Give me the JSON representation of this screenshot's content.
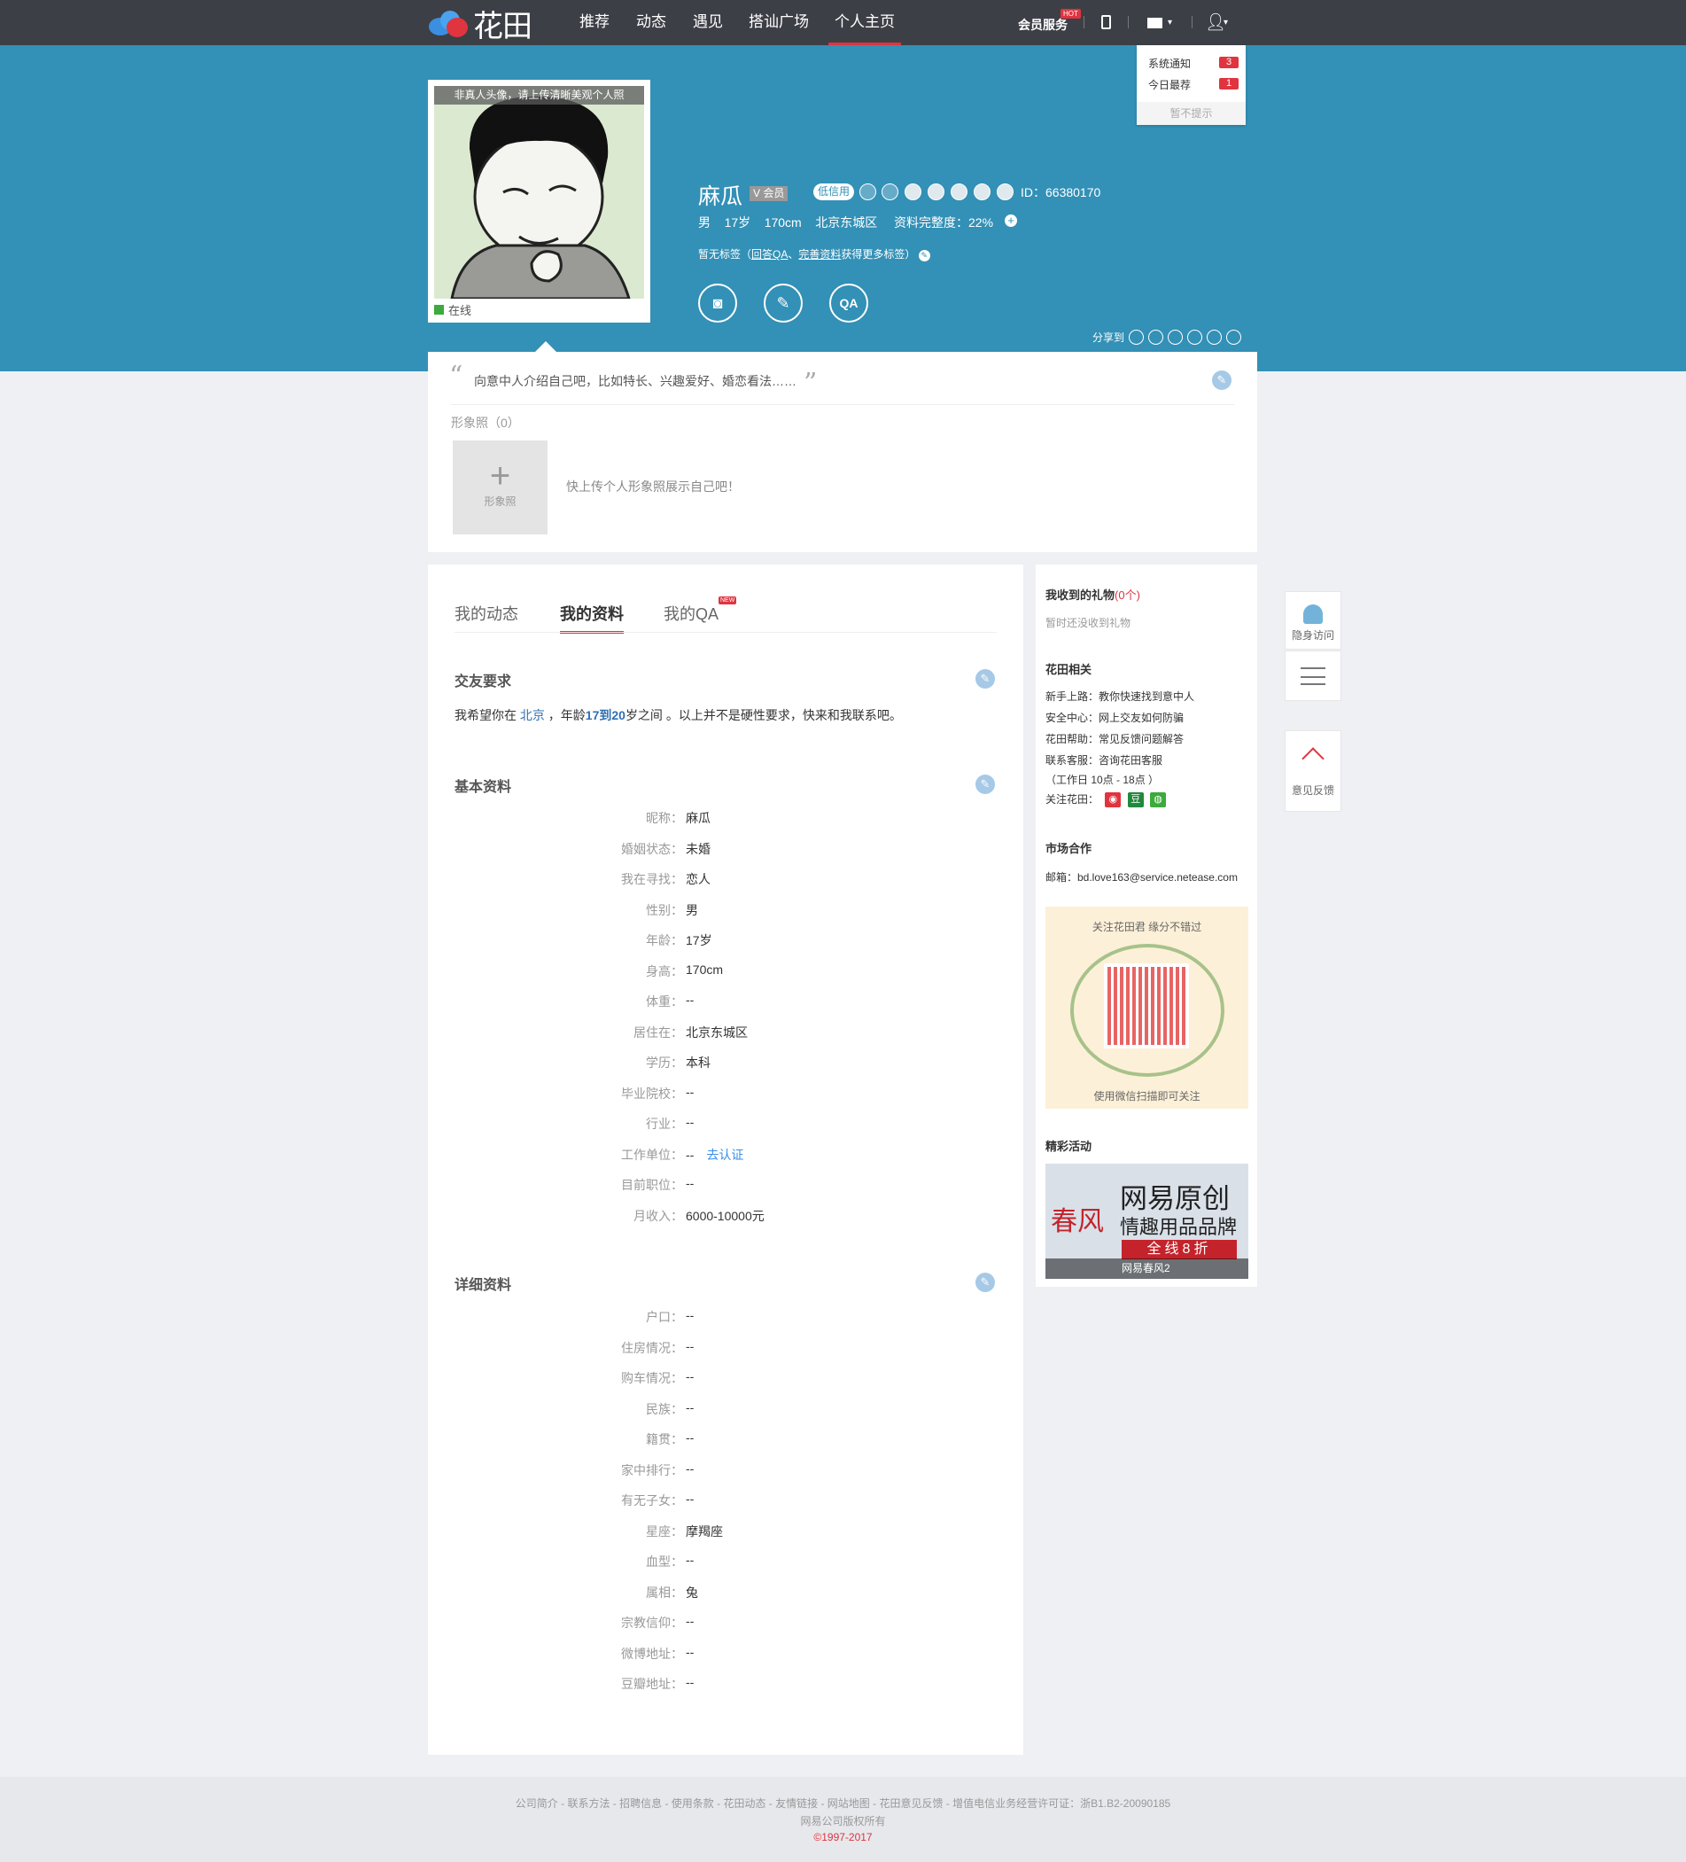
{
  "nav": {
    "logo": "花田",
    "items": [
      "推荐",
      "动态",
      "遇见",
      "搭讪广场",
      "个人主页"
    ],
    "vip": "会员服务",
    "hot": "HOT"
  },
  "notice": {
    "rows": [
      {
        "label": "系统通知",
        "count": "3"
      },
      {
        "label": "今日最荐",
        "count": "1"
      }
    ],
    "dismiss": "暂不提示"
  },
  "profile": {
    "avatar_tip": "非真人头像，请上传清晰美观个人照",
    "online": "在线",
    "name": "麻瓜",
    "vip": "会员",
    "credit": "低信用",
    "id": "ID：66380170",
    "gender": "男",
    "age": "17岁",
    "height": "170cm",
    "location": "北京东城区",
    "completeness": "资料完整度：22%",
    "tag_prefix": "暂无标签（",
    "tag_link1": "回答QA",
    "tag_sep": "、",
    "tag_link2": "完善资料",
    "tag_suffix": "获得更多标签）",
    "share": "分享到"
  },
  "intro": {
    "text": "向意中人介绍自己吧，比如特长、兴趣爱好、婚恋看法……",
    "photo_label": "形象照（0）",
    "add": "+",
    "add_label": "形象照",
    "photo_tip": "快上传个人形象照展示自己吧！"
  },
  "tabs": [
    "我的动态",
    "我的资料",
    "我的QA"
  ],
  "new_badge": "NEW",
  "requirement": {
    "title": "交友要求",
    "t1": "我希望你在 ",
    "city": "北京",
    "t2": " ，年龄",
    "age": "17到20",
    "t3": "岁之间 。以上并不是硬性要求，快来和我联系吧。"
  },
  "basic": {
    "title": "基本资料",
    "rows": [
      {
        "k": "昵称：",
        "v": "麻瓜"
      },
      {
        "k": "婚姻状态：",
        "v": "未婚"
      },
      {
        "k": "我在寻找：",
        "v": "恋人"
      },
      {
        "k": "性别：",
        "v": "男"
      },
      {
        "k": "年龄：",
        "v": "17岁"
      },
      {
        "k": "身高：",
        "v": "170cm"
      },
      {
        "k": "体重：",
        "v": "--"
      },
      {
        "k": "居住在：",
        "v": "北京东城区"
      },
      {
        "k": "学历：",
        "v": "本科"
      },
      {
        "k": "毕业院校：",
        "v": "--"
      },
      {
        "k": "行业：",
        "v": "--"
      },
      {
        "k": "工作单位：",
        "v": "--"
      },
      {
        "k": "目前职位：",
        "v": "--"
      },
      {
        "k": "月收入：",
        "v": "6000-10000元"
      }
    ],
    "verify": "去认证"
  },
  "detail": {
    "title": "详细资料",
    "rows": [
      {
        "k": "户口：",
        "v": "--"
      },
      {
        "k": "住房情况：",
        "v": "--"
      },
      {
        "k": "购车情况：",
        "v": "--"
      },
      {
        "k": "民族：",
        "v": "--"
      },
      {
        "k": "籍贯：",
        "v": "--"
      },
      {
        "k": "家中排行：",
        "v": "--"
      },
      {
        "k": "有无子女：",
        "v": "--"
      },
      {
        "k": "星座：",
        "v": "摩羯座"
      },
      {
        "k": "血型：",
        "v": "--"
      },
      {
        "k": "属相：",
        "v": "兔"
      },
      {
        "k": "宗教信仰：",
        "v": "--"
      },
      {
        "k": "微博地址：",
        "v": "--"
      },
      {
        "k": "豆瓣地址：",
        "v": "--"
      }
    ]
  },
  "side": {
    "gift_title": "我收到的礼物",
    "gift_count": "(0个)",
    "gift_empty": "暂时还没收到礼物",
    "related_title": "花田相关",
    "related": [
      {
        "k": "新手上路：",
        "v": "教你快速找到意中人"
      },
      {
        "k": "安全中心：",
        "v": "网上交友如何防骗"
      },
      {
        "k": "花田帮助：",
        "v": "常见反馈问题解答"
      },
      {
        "k": "联系客服：",
        "v": "咨询花田客服"
      }
    ],
    "hours": "（工作日 10点 - 18点 ）",
    "follow": "关注花田：",
    "market_title": "市场合作",
    "email": "邮箱：bd.love163@service.netease.com",
    "qr_top": "关注花田君 缘分不错过",
    "qr_bottom": "使用微信扫描即可关注",
    "events_title": "精彩活动",
    "ad_brand": "春风",
    "ad_big": "网易原创",
    "ad_mid": "情趣用品品牌",
    "ad_red": "全线8折",
    "ad_cap": "网易春风2"
  },
  "float": {
    "stealth": "隐身访问",
    "feedback": "意见反馈"
  },
  "footer": {
    "links": "公司简介 - 联系方法 - 招聘信息 - 使用条款 - 花田动态 - 友情链接 - 网站地图 - 花田意见反馈 - 增值电信业务经营许可证：浙B1.B2-20090185",
    "rights": "网易公司版权所有",
    "copy": "©1997-2017"
  }
}
